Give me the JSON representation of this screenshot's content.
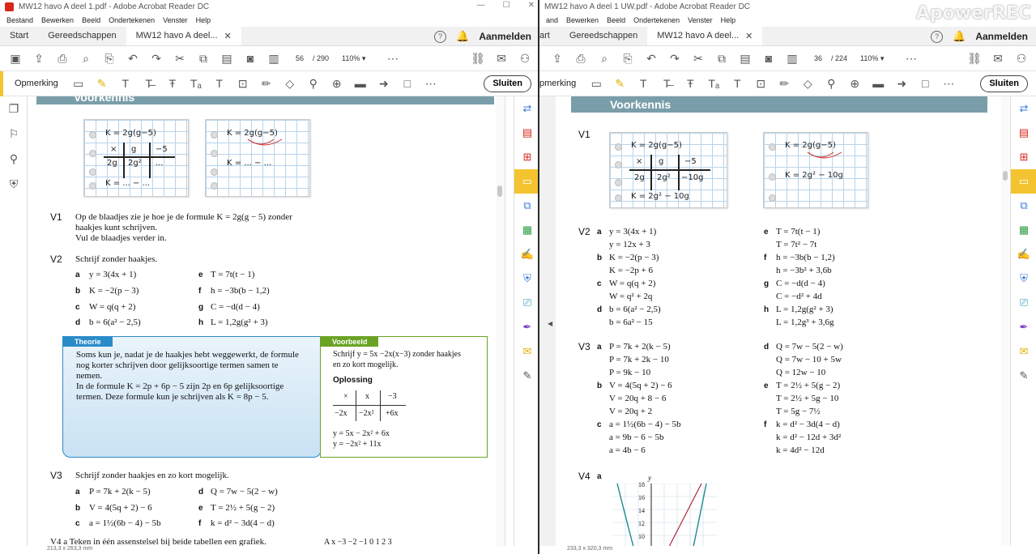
{
  "left": {
    "title": "MW12 havo A deel 1.pdf - Adobe Acrobat Reader DC",
    "menu": [
      "Bestand",
      "Bewerken",
      "Beeld",
      "Ondertekenen",
      "Venster",
      "Help"
    ],
    "tabs": [
      "Start",
      "Gereedschappen",
      "MW12 havo A deel..."
    ],
    "login": "Aanmelden",
    "page_current": "56",
    "page_total": "/ 290",
    "zoom": "110%",
    "annot_label": "Opmerking",
    "close_label": "Sluiten",
    "status": "213,3 x 263,3 mm",
    "banner": "Voorkennis",
    "sheet1": {
      "l1": "K = 2g(g−5)",
      "h1": "×",
      "h2": "g",
      "h3": "−5",
      "r1": "2g",
      "r2": "2g²",
      "r3": "...",
      "l4": "K = ... − ..."
    },
    "sheet2": {
      "l1": "K = 2g(g−5)",
      "l2": "K = ... − ..."
    },
    "v1": {
      "label": "V1",
      "line1": "Op de blaadjes zie je hoe je de formule K = 2g(g − 5) zonder",
      "line2": "haakjes kunt schrijven.",
      "line3": "Vul de blaadjes verder in."
    },
    "v2": {
      "label": "V2",
      "intro": "Schrijf zonder haakjes.",
      "items": [
        {
          "k": "a",
          "t": "y = 3(4x + 1)"
        },
        {
          "k": "e",
          "t": "T = 7t(t − 1)"
        },
        {
          "k": "b",
          "t": "K = −2(p − 3)"
        },
        {
          "k": "f",
          "t": "h = −3b(b − 1,2)"
        },
        {
          "k": "c",
          "t": "W = q(q + 2)"
        },
        {
          "k": "g",
          "t": "C = −d(d − 4)"
        },
        {
          "k": "d",
          "t": "b = 6(a² − 2,5)"
        },
        {
          "k": "h",
          "t": "L = 1,2g(g² + 3)"
        }
      ]
    },
    "theorie": {
      "title": "Theorie",
      "lines": [
        "Soms kun je, nadat je de haakjes hebt weggewerkt, de formule",
        "nog korter schrijven door gelijksoortige termen samen te",
        "nemen.",
        "In de formule K = 2p + 6p − 5 zijn 2p en 6p gelijksoortige",
        "termen. Deze formule kun je schrijven als K = 8p − 5."
      ]
    },
    "voorbeeld": {
      "title": "Voorbeeld",
      "lines": [
        "Schrijf y = 5x −2x(x−3) zonder haakjes",
        "en zo kort mogelijk."
      ],
      "oplossing": "Oplossing",
      "table": [
        [
          "×",
          "x",
          "−3"
        ],
        [
          "−2x",
          "−2x²",
          "+6x"
        ]
      ],
      "res1": "y = 5x − 2x² + 6x",
      "res2": "y = −2x² + 11x"
    },
    "v3": {
      "label": "V3",
      "intro": "Schrijf zonder haakjes en zo kort mogelijk.",
      "items": [
        {
          "k": "a",
          "t": "P = 7k + 2(k − 5)"
        },
        {
          "k": "d",
          "t": "Q = 7w − 5(2 − w)"
        },
        {
          "k": "b",
          "t": "V = 4(5q + 2) − 6"
        },
        {
          "k": "e",
          "t": "T = 2½ + 5(g − 2)"
        },
        {
          "k": "c",
          "t": "a = 1½(6b − 4) − 5b"
        },
        {
          "k": "f",
          "t": "k = d² − 3d(4 − d)"
        }
      ]
    },
    "v4_partial": "V4   a   Teken in één assenstelsel bij beide tabellen een grafiek.",
    "v4_table_partial": "A   x  −3  −2  −1   0    1    2    3"
  },
  "right": {
    "title": "MW12 havo A deel 1 UW.pdf - Adobe Acrobat Reader DC",
    "menu": [
      "and",
      "Bewerken",
      "Beeld",
      "Ondertekenen",
      "Venster",
      "Help"
    ],
    "tabs": [
      "art",
      "Gereedschappen",
      "MW12 havo A deel..."
    ],
    "login": "Aanmelden",
    "page_current": "36",
    "page_total": "/ 224",
    "zoom": "110%",
    "annot_label": "pmerking",
    "close_label": "Sluiten",
    "status": "233,3 x 320,3 mm",
    "watermark": "ApowerREC",
    "banner": "Voorkennis",
    "v1": {
      "label": "V1",
      "sheet1": {
        "l1": "K = 2g(g−5)",
        "h1": "×",
        "h2": "g",
        "h3": "−5",
        "r1": "2g",
        "r2": "2g²",
        "r3": "−10g",
        "l4": "K = 2g² − 10g"
      },
      "sheet2": {
        "l1": "K = 2g(g−5)",
        "l2": "K = 2g² − 10g"
      }
    },
    "v2": {
      "label": "V2",
      "items": [
        {
          "k": "a",
          "l1": "y = 3(4x + 1)",
          "l2": "y = 12x + 3"
        },
        {
          "k": "e",
          "l1": "T = 7t(t − 1)",
          "l2": "T = 7t² − 7t"
        },
        {
          "k": "b",
          "l1": "K = −2(p − 3)",
          "l2": "K = −2p + 6"
        },
        {
          "k": "f",
          "l1": "h = −3b(b − 1,2)",
          "l2": "h = −3b² + 3,6b"
        },
        {
          "k": "c",
          "l1": "W = q(q + 2)",
          "l2": "W = q² + 2q"
        },
        {
          "k": "g",
          "l1": "C = −d(d − 4)",
          "l2": "C = −d² + 4d"
        },
        {
          "k": "d",
          "l1": "b = 6(a² − 2,5)",
          "l2": "b = 6a² − 15"
        },
        {
          "k": "h",
          "l1": "L = 1,2g(g² + 3)",
          "l2": "L = 1,2g³ + 3,6g"
        }
      ]
    },
    "v3": {
      "label": "V3",
      "items": [
        {
          "k": "a",
          "l1": "P = 7k + 2(k − 5)",
          "l2": "P = 7k + 2k − 10",
          "l3": "P = 9k − 10"
        },
        {
          "k": "d",
          "l1": "Q = 7w − 5(2 − w)",
          "l2": "Q = 7w − 10 + 5w",
          "l3": "Q = 12w − 10"
        },
        {
          "k": "b",
          "l1": "V = 4(5q + 2) − 6",
          "l2": "V = 20q + 8 − 6",
          "l3": "V = 20q + 2"
        },
        {
          "k": "e",
          "l1": "T = 2½ + 5(g − 2)",
          "l2": "T = 2½ + 5g − 10",
          "l3": "T = 5g − 7½"
        },
        {
          "k": "c",
          "l1": "a = 1½(6b − 4) − 5b",
          "l2": "a = 9b − 6 − 5b",
          "l3": "a = 4b − 6"
        },
        {
          "k": "f",
          "l1": "k = d² − 3d(4 − d)",
          "l2": "k = d² − 12d + 3d²",
          "l3": "k = 4d² − 12d"
        }
      ]
    },
    "v4": {
      "label": "V4",
      "part": "a",
      "ylabel": "y",
      "yticks": [
        "18",
        "16",
        "14",
        "12",
        "10"
      ]
    }
  }
}
